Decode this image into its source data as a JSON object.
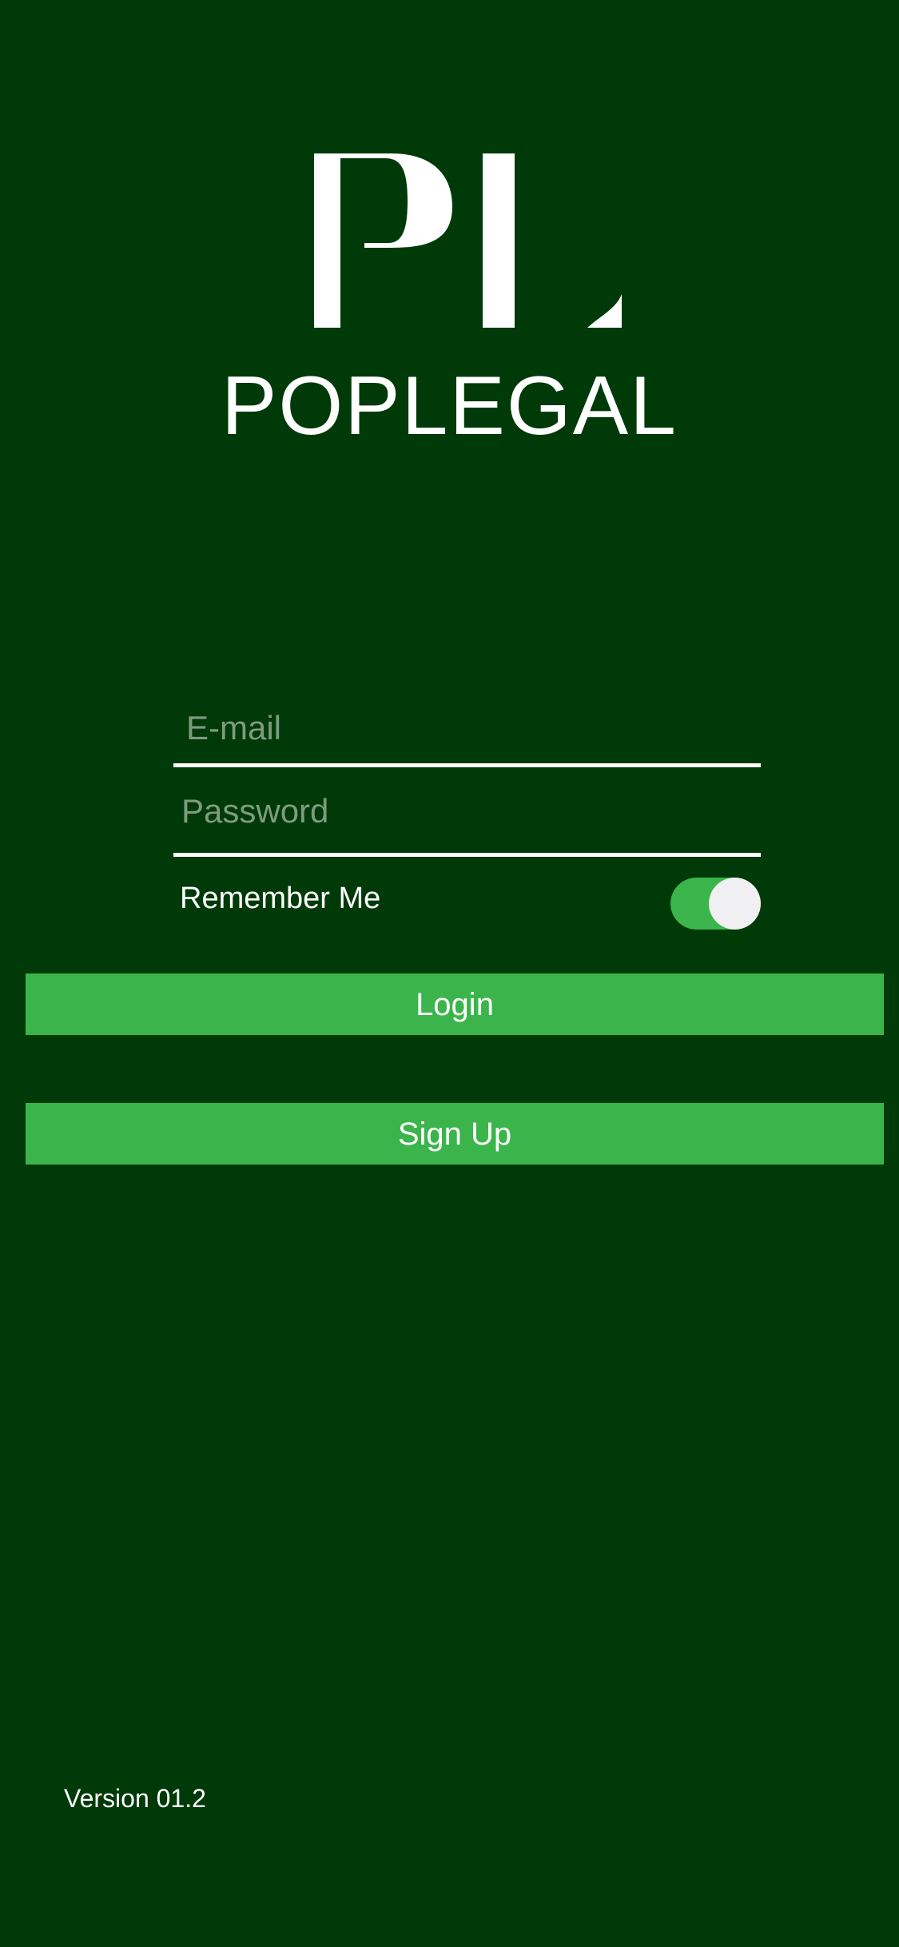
{
  "colors": {
    "background": "#003a08",
    "accent": "#3bb54b",
    "text": "#ffffff",
    "placeholder": "#7f9b7f",
    "toggle_knob": "#f0f0f2"
  },
  "brand": {
    "logo_icon": "pl-monogram-icon",
    "name": "POPLEGAL"
  },
  "form": {
    "email": {
      "value": "",
      "placeholder": "E-mail"
    },
    "password": {
      "value": "",
      "placeholder": "Password"
    },
    "remember_me": {
      "label": "Remember Me",
      "checked": true
    }
  },
  "buttons": {
    "login_label": "Login",
    "signup_label": "Sign Up"
  },
  "footer": {
    "version": "Version 01.2"
  }
}
